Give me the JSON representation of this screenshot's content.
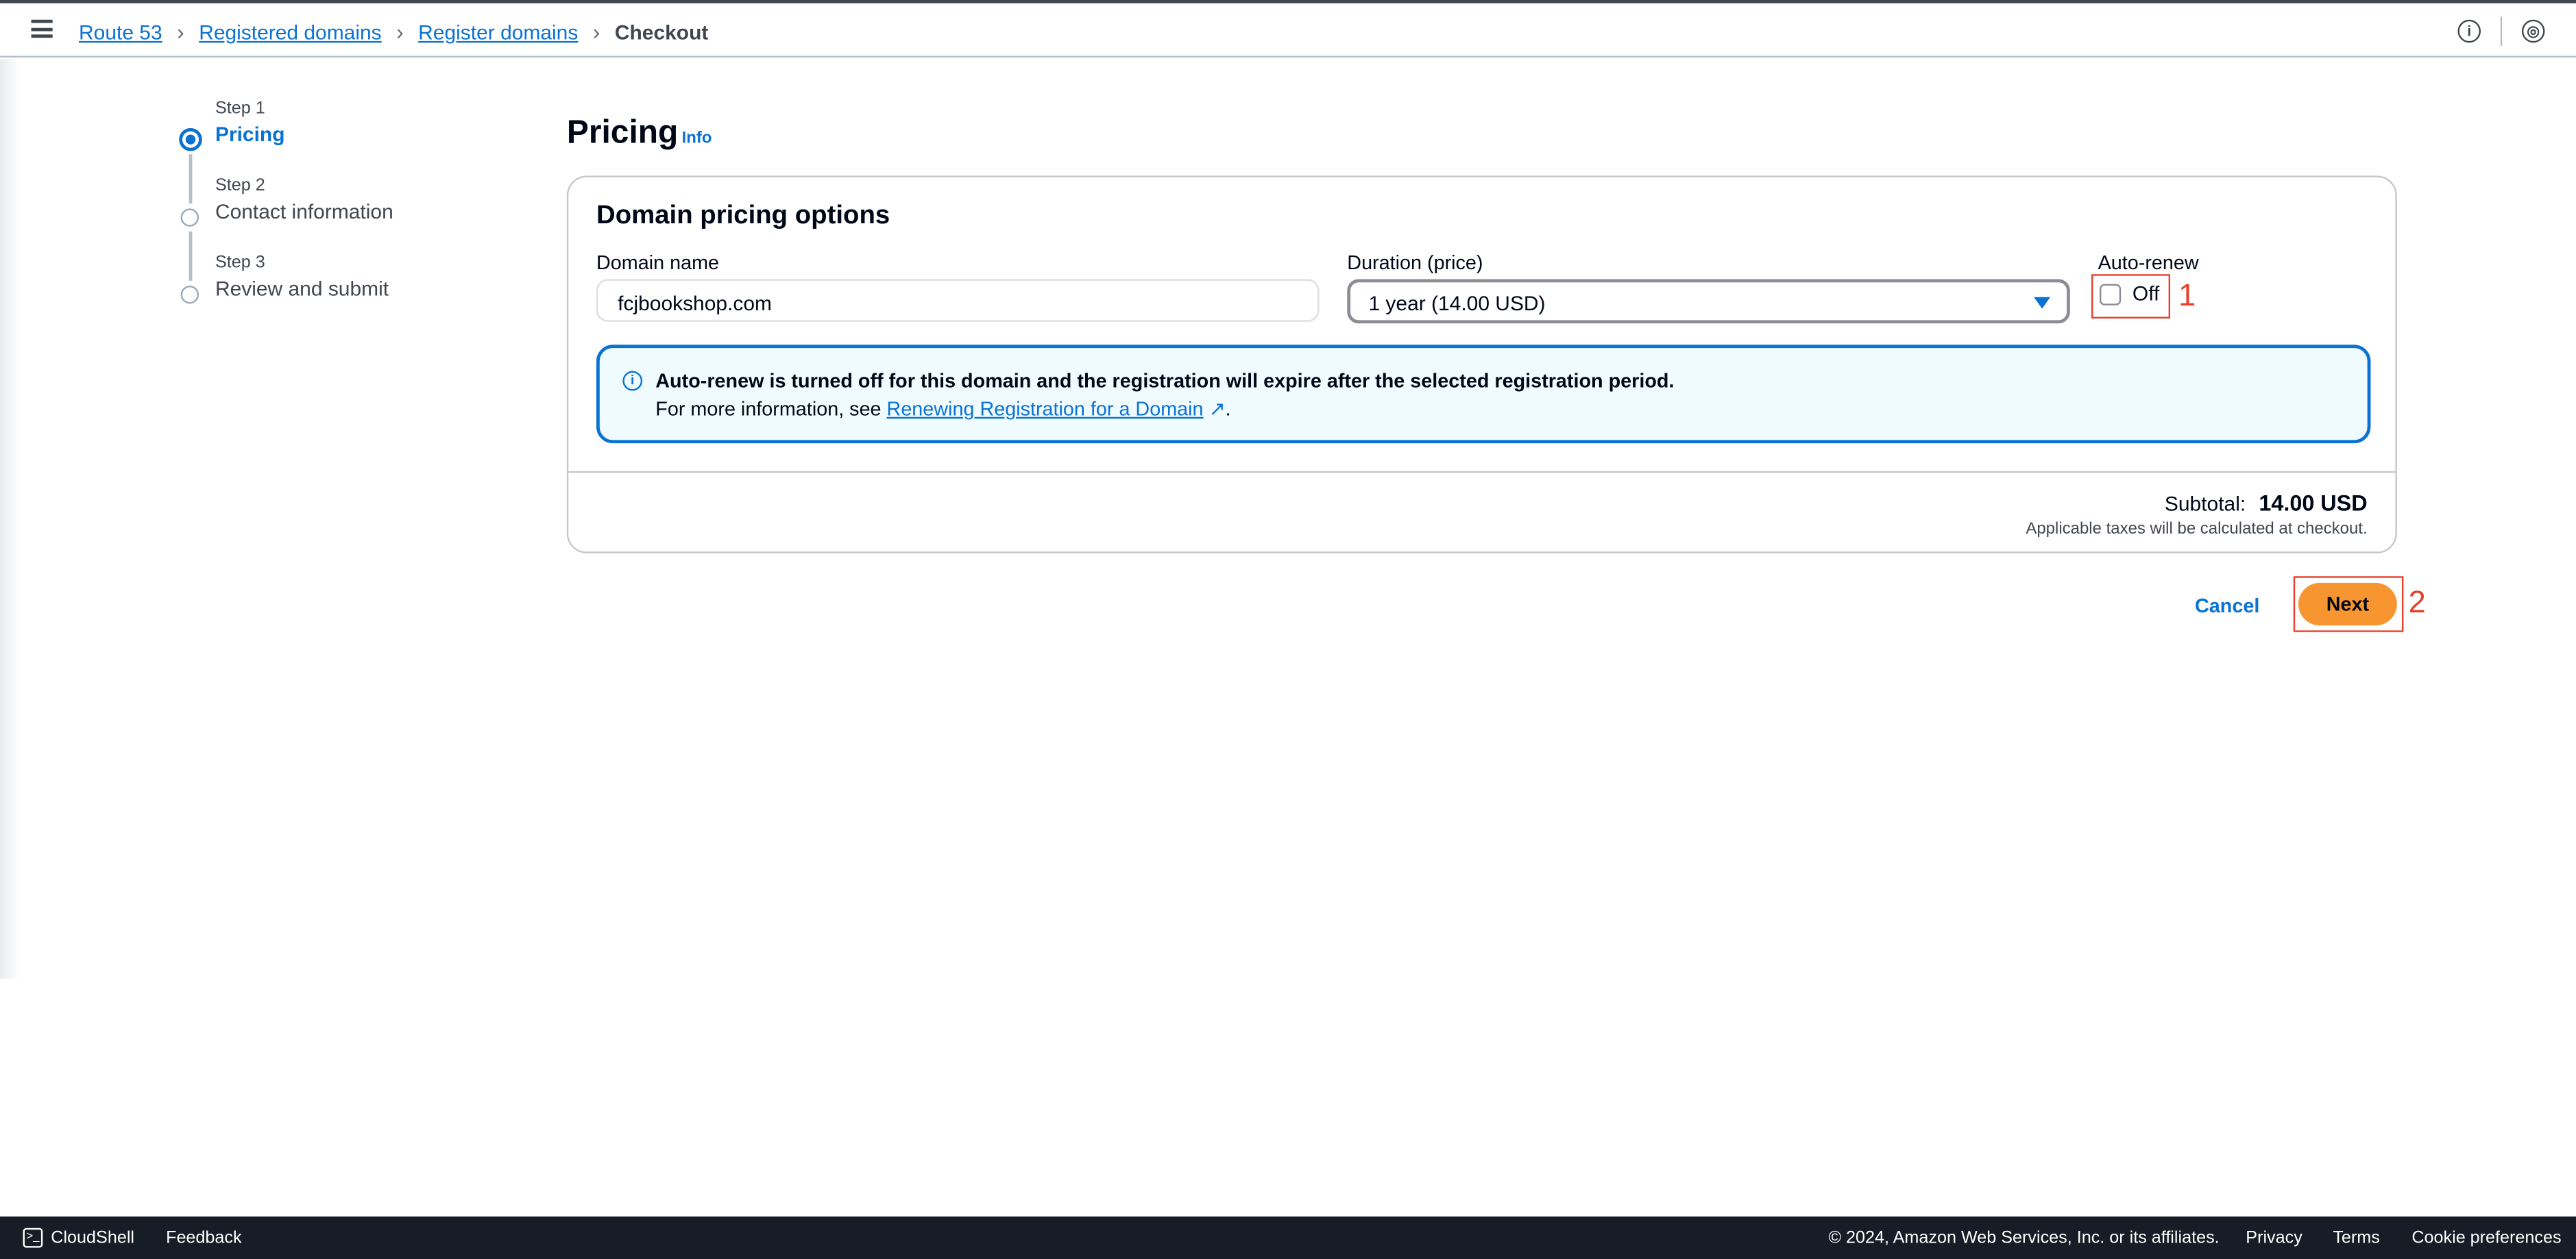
{
  "breadcrumb": {
    "items": [
      "Route 53",
      "Registered domains",
      "Register domains"
    ],
    "current": "Checkout"
  },
  "steps": [
    {
      "label": "Step 1",
      "name": "Pricing",
      "active": true
    },
    {
      "label": "Step 2",
      "name": "Contact information",
      "active": false
    },
    {
      "label": "Step 3",
      "name": "Review and submit",
      "active": false
    }
  ],
  "page": {
    "title": "Pricing",
    "info": "Info"
  },
  "card": {
    "title": "Domain pricing options",
    "domain_label": "Domain name",
    "domain_value": "fcjbookshop.com",
    "duration_label": "Duration (price)",
    "duration_value": "1 year (14.00 USD)",
    "autorenew_label": "Auto-renew",
    "autorenew_value": "Off",
    "autorenew_checked": false,
    "alert_title": "Auto-renew is turned off for this domain and the registration will expire after the selected registration period.",
    "alert_prefix": "For more information, see ",
    "alert_link": "Renewing Registration for a Domain",
    "alert_suffix": ".",
    "subtotal_label": "Subtotal:",
    "subtotal_value": "14.00 USD",
    "tax_note": "Applicable taxes will be calculated at checkout."
  },
  "actions": {
    "cancel": "Cancel",
    "next": "Next"
  },
  "annotations": [
    "1",
    "2"
  ],
  "footer": {
    "cloudshell": "CloudShell",
    "feedback": "Feedback",
    "copyright": "© 2024, Amazon Web Services, Inc. or its affiliates.",
    "privacy": "Privacy",
    "terms": "Terms",
    "cookies": "Cookie preferences"
  },
  "colors": {
    "accent": "#0972d3",
    "primary_button": "#f79530",
    "annotation": "#e8402a",
    "footer_bg": "#161d26"
  }
}
